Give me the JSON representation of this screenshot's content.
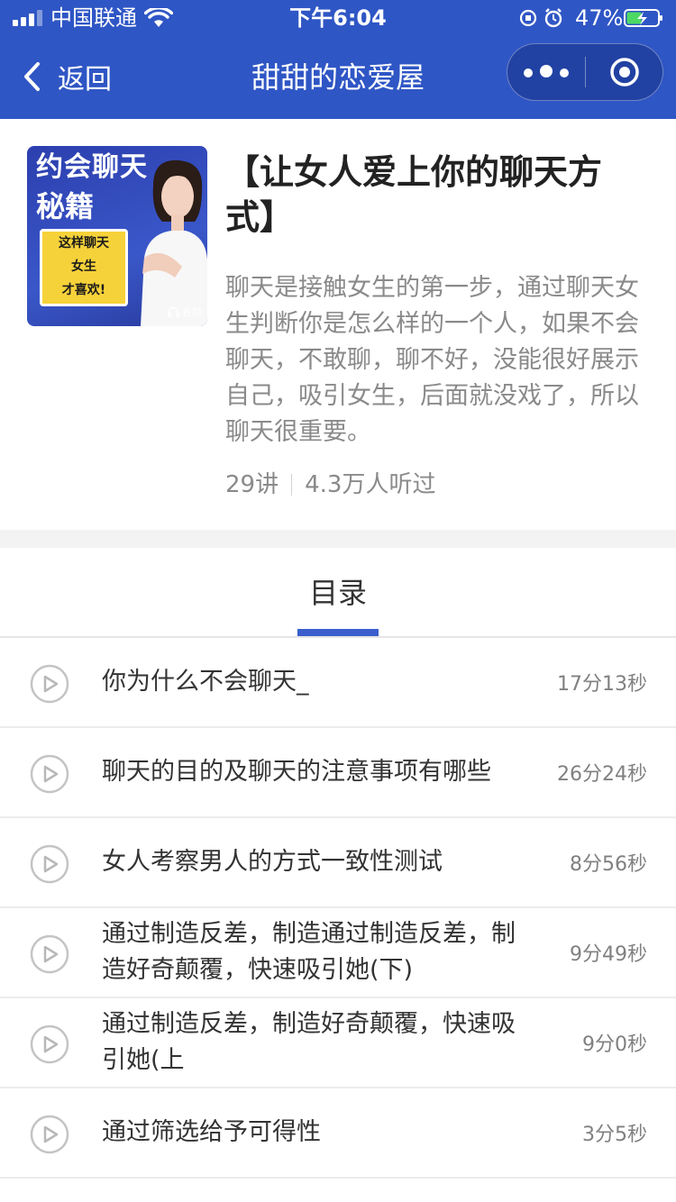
{
  "status_bar": {
    "carrier": "中国联通",
    "time": "下午6:04",
    "battery": "47%"
  },
  "nav": {
    "back_label": "返回",
    "title": "甜甜的恋爱屋"
  },
  "cover": {
    "line1": "约会聊天",
    "line2": "秘籍",
    "bubble": [
      "这样聊天",
      "女生",
      "才喜欢!"
    ],
    "audio_tag": "音频"
  },
  "course": {
    "title": "【让女人爱上你的聊天方式】",
    "description": "聊天是接触女生的第一步，通过聊天女生判断你是怎么样的一个人，如果不会聊天，不敢聊，聊不好，没能很好展示自己，吸引女生，后面就没戏了，所以聊天很重要。",
    "lessons": "29讲",
    "listeners": "4.3万人听过"
  },
  "tabs": {
    "catalog": "目录"
  },
  "episodes": [
    {
      "title": "你为什么不会聊天_",
      "duration": "17分13秒"
    },
    {
      "title": "聊天的目的及聊天的注意事项有哪些",
      "duration": "26分24秒"
    },
    {
      "title": "女人考察男人的方式一致性测试",
      "duration": "8分56秒"
    },
    {
      "title": "通过制造反差，制造通过制造反差，制造好奇颠覆，快速吸引她(下)",
      "duration": "9分49秒"
    },
    {
      "title": "通过制造反差，制造好奇颠覆，快速吸引她(上",
      "duration": "9分0秒"
    },
    {
      "title": "通过筛选给予可得性",
      "duration": "3分5秒"
    }
  ],
  "colors": {
    "nav_bg": "#2f56c5",
    "tab_indicator": "#3a5fcc",
    "battery_fill": "#4cd964"
  },
  "icons": [
    "signal-icon",
    "wifi-icon",
    "orientation-lock-icon",
    "alarm-icon",
    "battery-icon",
    "back-arrow-icon",
    "more-dots-icon",
    "target-close-icon",
    "headphone-icon",
    "play-circle-icon"
  ]
}
